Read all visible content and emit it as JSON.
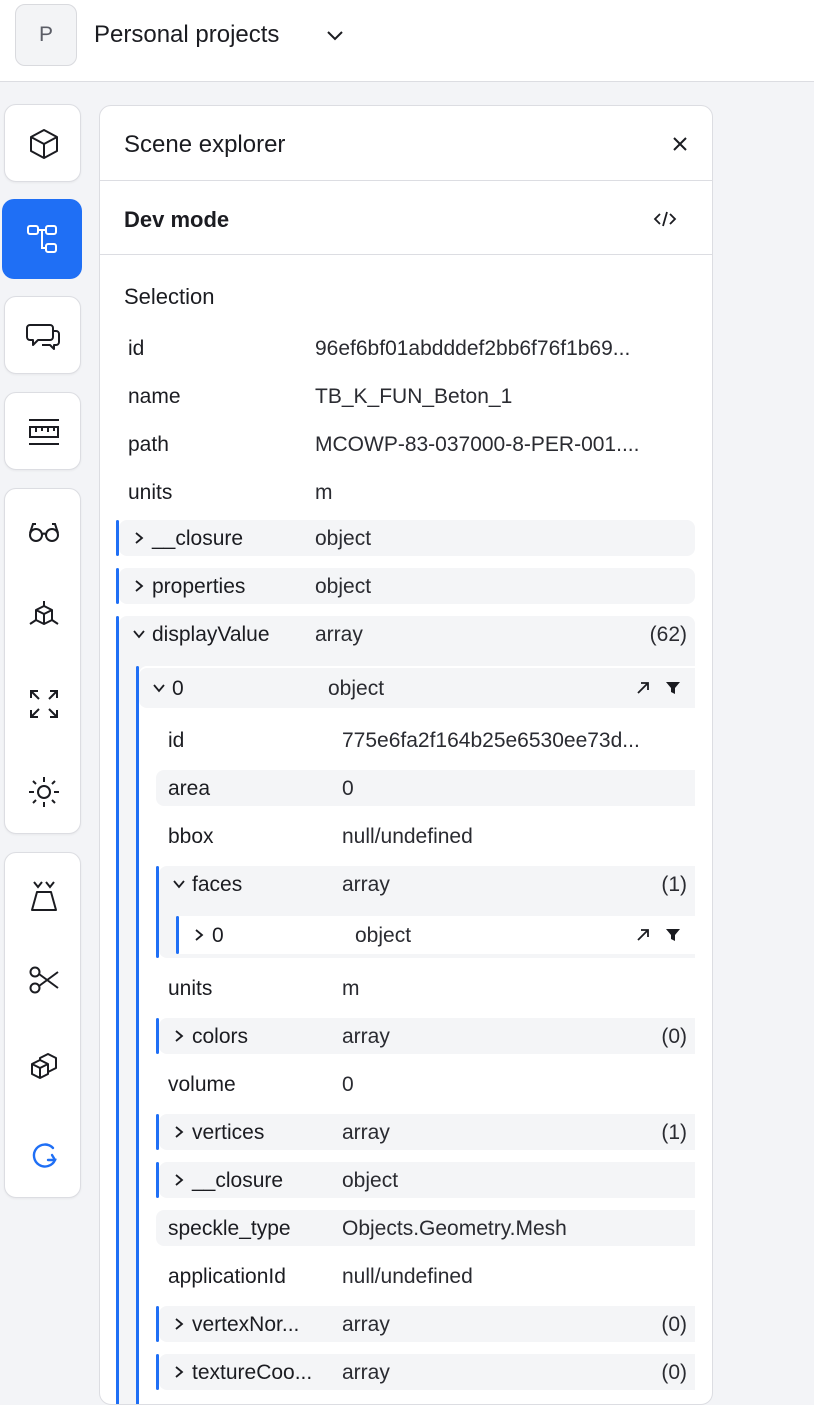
{
  "workspace": {
    "initial": "P",
    "name": "Personal projects"
  },
  "panel": {
    "title": "Scene explorer",
    "dev_mode": "Dev mode",
    "selection_title": "Selection"
  },
  "selection": {
    "id_key": "id",
    "id_val": "96ef6bf01abdddef2bb6f76f1b69...",
    "name_key": "name",
    "name_val": "TB_K_FUN_Beton_1",
    "path_key": "path",
    "path_val": "MCOWP-83-037000-8-PER-001....",
    "units_key": "units",
    "units_val": "m",
    "closure_key": "__closure",
    "closure_val": "object",
    "properties_key": "properties",
    "properties_val": "object",
    "display_key": "displayValue",
    "display_val": "array",
    "display_cnt": "(62)"
  },
  "item0": {
    "key": "0",
    "val": "object",
    "id_key": "id",
    "id_val": "775e6fa2f164b25e6530ee73d...",
    "area_key": "area",
    "area_val": "0",
    "bbox_key": "bbox",
    "bbox_val": "null/undefined",
    "faces_key": "faces",
    "faces_val": "array",
    "faces_cnt": "(1)",
    "faces0_key": "0",
    "faces0_val": "object",
    "units_key": "units",
    "units_val": "m",
    "colors_key": "colors",
    "colors_val": "array",
    "colors_cnt": "(0)",
    "volume_key": "volume",
    "volume_val": "0",
    "vertices_key": "vertices",
    "vertices_val": "array",
    "vertices_cnt": "(1)",
    "closure_key": "__closure",
    "closure_val": "object",
    "stype_key": "speckle_type",
    "stype_val": "Objects.Geometry.Mesh",
    "appid_key": "applicationId",
    "appid_val": "null/undefined",
    "vnorm_key": "vertexNor...",
    "vnorm_val": "array",
    "vnorm_cnt": "(0)",
    "texco_key": "textureCoo...",
    "texco_val": "array",
    "texco_cnt": "(0)"
  },
  "icons": [
    "chevron-down-icon",
    "cube-icon",
    "scene-tree-icon",
    "comments-icon",
    "ruler-icon",
    "glasses-icon",
    "explode-icon",
    "zoom-extents-icon",
    "sun-icon",
    "perspective-icon",
    "scissors-icon",
    "isolate-icon",
    "reset-icon",
    "close-icon",
    "code-icon",
    "open-icon",
    "filter-icon"
  ],
  "colors": {
    "accent": "#1f6ff5",
    "row_shade": "#f4f5f7"
  }
}
